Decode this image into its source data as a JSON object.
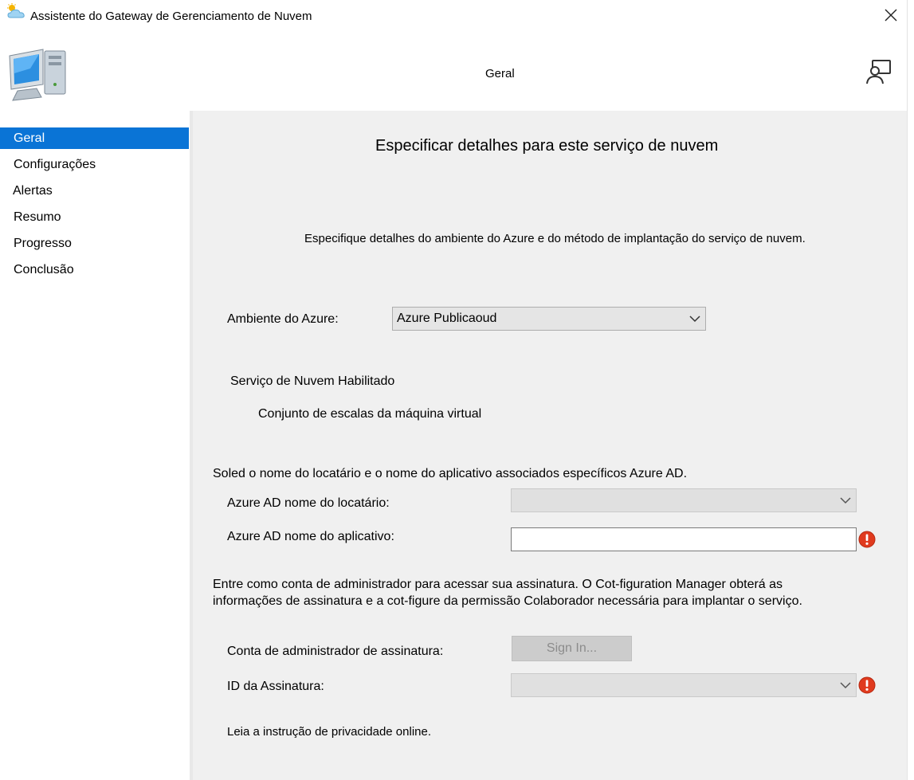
{
  "window": {
    "title": "Assistente do Gateway de Gerenciamento de Nuvem",
    "icons": {
      "app": "cloud-sun-icon",
      "close": "close-icon"
    }
  },
  "header": {
    "title": "Geral",
    "icons": {
      "computer": "computer-icon",
      "help": "help-person-icon"
    }
  },
  "sidebar": {
    "items": [
      {
        "label": "Geral",
        "active": true
      },
      {
        "label": "Configurações",
        "active": false
      },
      {
        "label": "Alertas",
        "active": false
      },
      {
        "label": "Resumo",
        "active": false
      },
      {
        "label": "Progresso",
        "active": false
      },
      {
        "label": "Conclusão",
        "active": false
      }
    ]
  },
  "main": {
    "heading": "Especificar detalhes para este serviço de nuvem",
    "intro": "Especifique detalhes do ambiente do Azure e do método de implantação do serviço de nuvem.",
    "azure_env": {
      "label": "Ambiente do Azure:",
      "value": "Azure Publicaoud"
    },
    "cloud_service": {
      "label": "Serviço de Nuvem Habilitado",
      "option": "Conjunto de escalas da máquina virtual"
    },
    "aad_section": "Soled o nome do locatário e o nome do aplicativo associados específicos Azure AD.",
    "tenant": {
      "label": "Azure AD nome do locatário:",
      "value": ""
    },
    "app": {
      "label": "Azure AD nome do aplicativo:",
      "value": ""
    },
    "signin_text_1": "Entre como conta de administrador para acessar sua assinatura. O Cot-figuration Manager obterá as",
    "signin_text_2": "informações de assinatura e a cot-figure da permissão Colaborador necessária para implantar o serviço.",
    "admin": {
      "label": "Conta de administrador de assinatura:",
      "button": "Sign In..."
    },
    "subscription": {
      "label": "ID da Assinatura:",
      "value": ""
    },
    "privacy": "Leia a instrução de privacidade online."
  },
  "colors": {
    "accent": "#0a74d6",
    "error": "#e03a1e",
    "content_bg": "#f0f0f0"
  }
}
